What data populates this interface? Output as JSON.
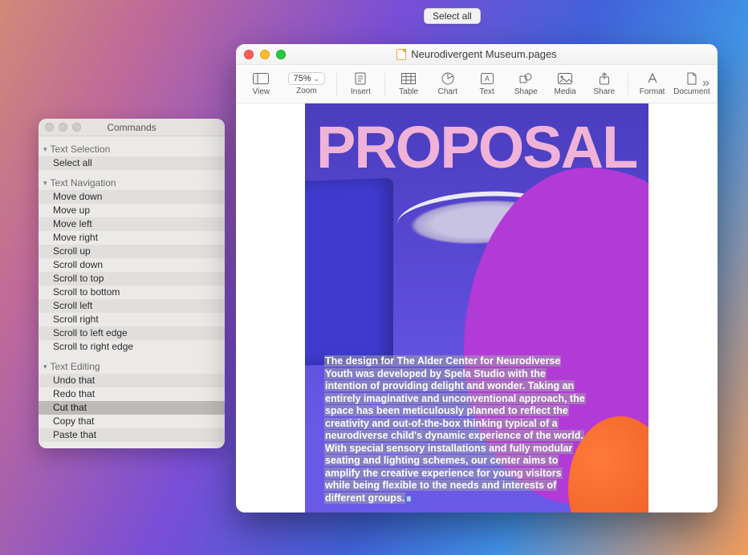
{
  "tooltip": {
    "text": "Select all"
  },
  "commands_panel": {
    "title": "Commands",
    "groups": [
      {
        "name": "Text Selection",
        "items": [
          "Select all"
        ]
      },
      {
        "name": "Text Navigation",
        "items": [
          "Move down",
          "Move up",
          "Move left",
          "Move right",
          "Scroll up",
          "Scroll down",
          "Scroll to top",
          "Scroll to bottom",
          "Scroll left",
          "Scroll right",
          "Scroll to left edge",
          "Scroll to right edge"
        ]
      },
      {
        "name": "Text Editing",
        "items": [
          "Undo that",
          "Redo that",
          "Cut that",
          "Copy that",
          "Paste that"
        ]
      }
    ],
    "selected_item": "Cut that"
  },
  "pages_window": {
    "document_title": "Neurodivergent Museum.pages",
    "toolbar": {
      "view": "View",
      "zoom_label": "Zoom",
      "zoom_value": "75%",
      "insert": "Insert",
      "table": "Table",
      "chart": "Chart",
      "text": "Text",
      "shape": "Shape",
      "media": "Media",
      "share": "Share",
      "format": "Format",
      "document": "Document"
    },
    "page": {
      "heading": "PROPOSAL",
      "body": "The design for The Alder Center for Neurodiverse Youth was developed by Spela Studio with the intention of providing delight and wonder. Taking an entirely imaginative and unconventional approach, the space has been meticulously planned to reflect the creativity and out-of-the-box thinking typical of a neurodiverse child's dynamic experience of the world. With special sensory installations and fully modular seating and lighting schemes, our center aims to amplify the creative experience for young visitors while being flexible to the needs and interests of different groups."
    }
  }
}
